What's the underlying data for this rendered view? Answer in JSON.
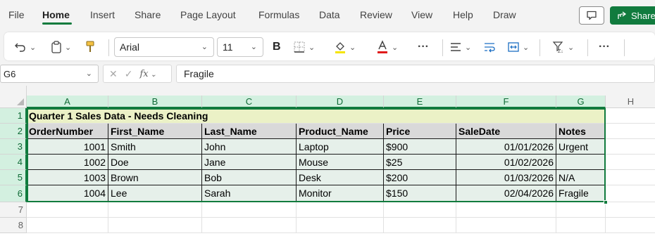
{
  "menu": {
    "items": [
      "File",
      "Home",
      "Insert",
      "Share",
      "Page Layout",
      "Formulas",
      "Data",
      "Review",
      "View",
      "Help",
      "Draw"
    ],
    "active": "Home",
    "share_label": "Share"
  },
  "ribbon": {
    "font_name": "Arial",
    "font_size": "11",
    "bold_label": "B",
    "more_label": "···"
  },
  "formula_bar": {
    "name_box": "G6",
    "fx_label": "fx",
    "formula_value": "Fragile"
  },
  "sheet": {
    "columns": [
      "A",
      "B",
      "C",
      "D",
      "E",
      "F",
      "G",
      "H"
    ],
    "rows": [
      "1",
      "2",
      "3",
      "4",
      "5",
      "6",
      "7",
      "8"
    ],
    "title": "Quarter 1 Sales Data - Needs Cleaning",
    "headers": [
      "OrderNumber",
      "First_Name",
      "Last_Name",
      "Product_Name",
      "Price",
      "SaleDate",
      "Notes"
    ],
    "data": [
      [
        "1001",
        "Smith",
        "John",
        "Laptop",
        "$900",
        "01/01/2026",
        "Urgent"
      ],
      [
        "1002",
        "Doe",
        "Jane",
        "Mouse",
        "$25",
        "01/02/2026",
        ""
      ],
      [
        "1003",
        "Brown",
        "Bob",
        "Desk",
        "$200",
        "01/03/2026",
        "N/A"
      ],
      [
        "1004",
        "Lee",
        "Sarah",
        "Monitor",
        "$150",
        "02/04/2026",
        "Fragile"
      ]
    ]
  },
  "colors": {
    "accent": "#117b3e",
    "title_fill": "#ebf1c6",
    "header_fill": "#d9d9d9",
    "selection_fill": "#e6f0ea"
  }
}
